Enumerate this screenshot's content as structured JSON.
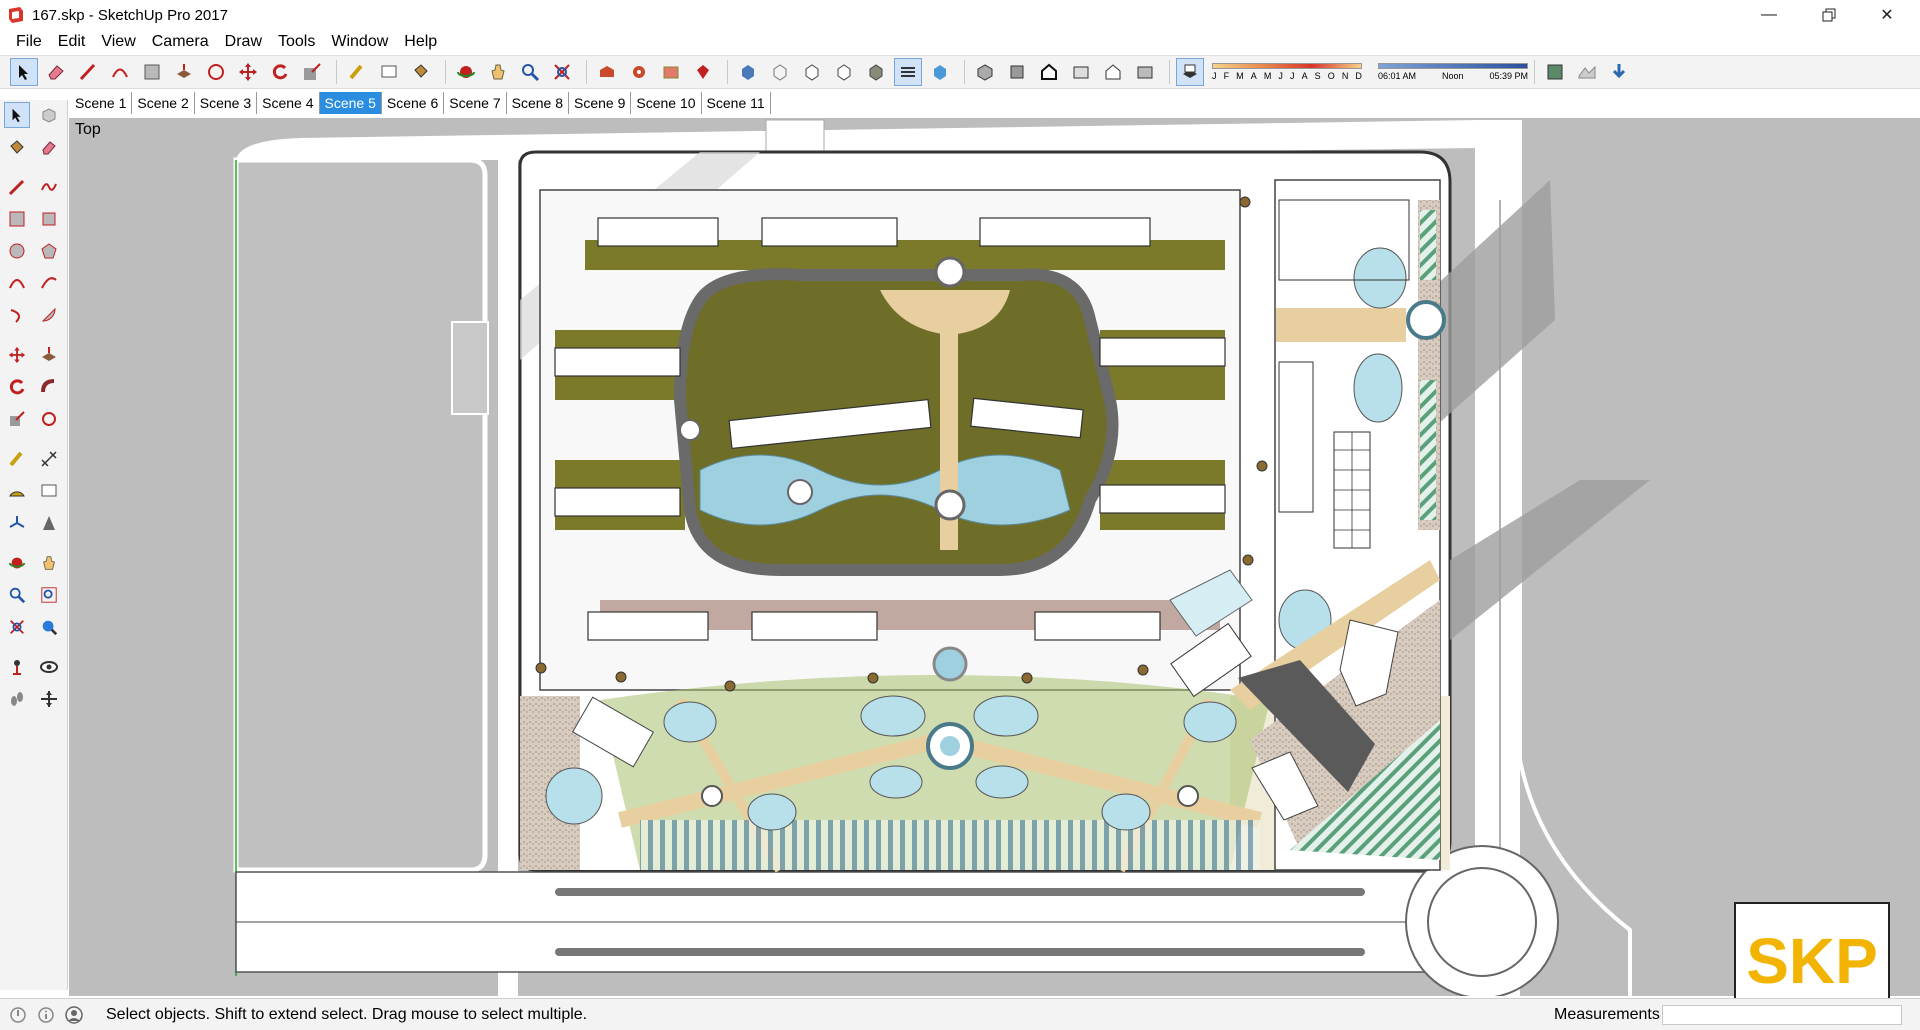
{
  "window": {
    "title": "167.skp - SketchUp Pro 2017",
    "controls": [
      "minimize-icon",
      "restore-icon",
      "close-icon"
    ]
  },
  "menu": [
    "File",
    "Edit",
    "View",
    "Camera",
    "Draw",
    "Tools",
    "Window",
    "Help"
  ],
  "toolbar": {
    "shadow_months": [
      "J",
      "F",
      "M",
      "A",
      "M",
      "J",
      "J",
      "A",
      "S",
      "O",
      "N",
      "D"
    ],
    "shadow_time_start": "06:01 AM",
    "shadow_time_mid": "Noon",
    "shadow_time_end": "05:39 PM",
    "active_tool": "select-tool"
  },
  "scenes": {
    "tabs": [
      "Scene 1",
      "Scene 2",
      "Scene 3",
      "Scene 4",
      "Scene 5",
      "Scene 6",
      "Scene 7",
      "Scene 8",
      "Scene 9",
      "Scene 10",
      "Scene 11"
    ],
    "active": "Scene 5"
  },
  "viewport": {
    "view_label": "Top"
  },
  "statusbar": {
    "message": "Select objects. Shift to extend select. Drag mouse to select multiple.",
    "measurements_label": "Measurements",
    "measurements_value": ""
  },
  "watermark": {
    "text": "SKP"
  },
  "colors": {
    "viewport_bg": "#bdbdbd",
    "active_scene": "#2a8de0",
    "lawn": "#7a7a2a",
    "water": "#9fd0e0",
    "paving": "#e8cfa0",
    "logo": "#f2b400"
  }
}
